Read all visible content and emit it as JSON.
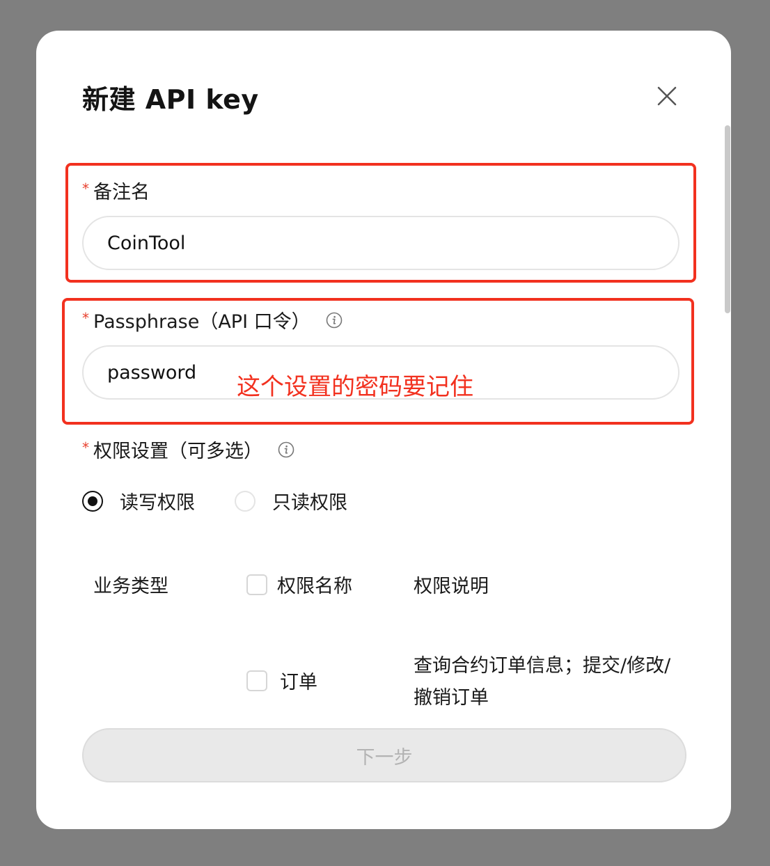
{
  "modal": {
    "title": "新建 API key"
  },
  "remark": {
    "required_mark": "*",
    "label": "备注名",
    "value": "CoinTool"
  },
  "passphrase": {
    "required_mark": "*",
    "label": "Passphrase（API 口令）",
    "value": "password",
    "annotation": "这个设置的密码要记住"
  },
  "permissions": {
    "required_mark": "*",
    "label": "权限设置（可多选）",
    "options": [
      {
        "label": "读写权限",
        "selected": true
      },
      {
        "label": "只读权限",
        "selected": false
      }
    ],
    "table": {
      "headers": {
        "business_type": "业务类型",
        "perm_name": "权限名称",
        "perm_desc": "权限说明"
      },
      "rows": [
        {
          "business_type": "",
          "perm_name": "订单",
          "perm_desc": "查询合约订单信息；提交/修改/撤销订单",
          "checked": false
        }
      ]
    }
  },
  "footer": {
    "next_label": "下一步"
  },
  "colors": {
    "highlight": "#f2311f",
    "backdrop": "#7f7f7f"
  }
}
